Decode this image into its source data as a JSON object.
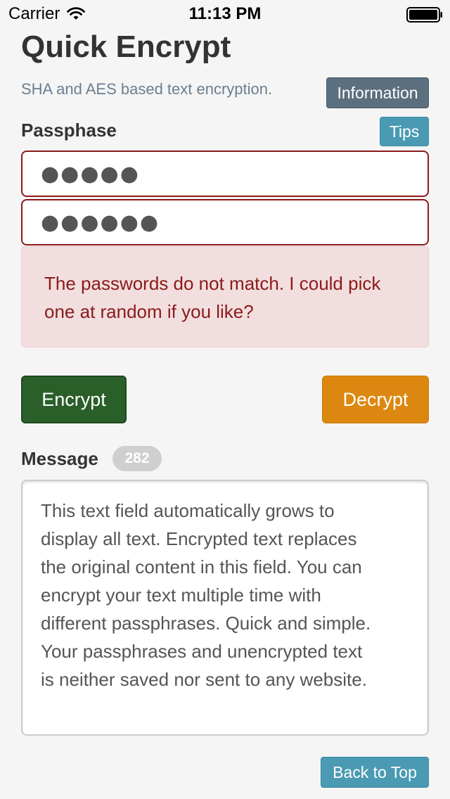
{
  "status_bar": {
    "carrier": "Carrier",
    "time": "11:13 PM",
    "wifi_icon": "wifi-icon",
    "battery_icon": "battery-icon"
  },
  "header": {
    "title": "Quick Encrypt",
    "subtitle": "SHA and AES based text encryption.",
    "information_label": "Information"
  },
  "passphrase": {
    "label": "Passphase",
    "tips_label": "Tips",
    "field1_value": "●●●●●",
    "field2_value": "●●●●●●"
  },
  "alert": {
    "text": "The passwords do not match. I could pick one at random if you like?"
  },
  "actions": {
    "encrypt_label": "Encrypt",
    "decrypt_label": "Decrypt"
  },
  "message": {
    "label": "Message",
    "count": "282",
    "text": "This text field automatically grows to\ndisplay all text. Encrypted text replaces\nthe original content in this field. You can\nencrypt your text multiple time with\ndifferent passphrases. Quick and simple.\nYour passphrases and unencrypted text\nis neither saved nor sent to any website."
  },
  "footer": {
    "back_to_top_label": "Back to Top"
  },
  "colors": {
    "background": "#f5f5f5",
    "info_button": "#5b6f7f",
    "tips_button": "#4a9ab3",
    "error_border": "#8b1a1a",
    "alert_bg": "#f2dede",
    "encrypt_button": "#2a5f2a",
    "decrypt_button": "#dc8810"
  }
}
